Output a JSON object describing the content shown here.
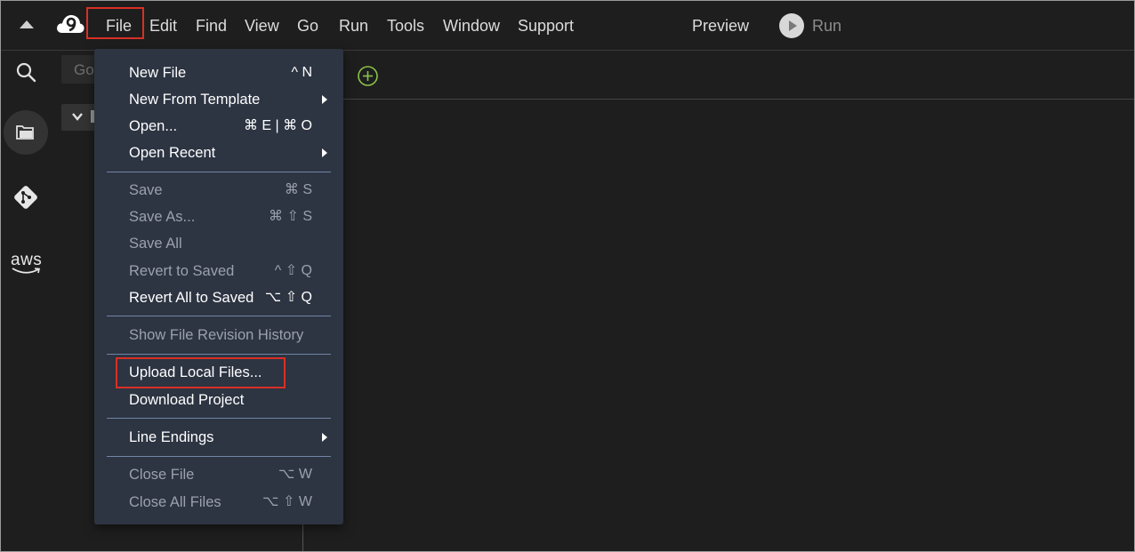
{
  "menubar": {
    "items": [
      {
        "id": "file",
        "label": "File"
      },
      {
        "id": "edit",
        "label": "Edit"
      },
      {
        "id": "find",
        "label": "Find"
      },
      {
        "id": "view",
        "label": "View"
      },
      {
        "id": "go",
        "label": "Go"
      },
      {
        "id": "run",
        "label": "Run"
      },
      {
        "id": "tools",
        "label": "Tools"
      },
      {
        "id": "window",
        "label": "Window"
      },
      {
        "id": "support",
        "label": "Support"
      }
    ],
    "preview_label": "Preview",
    "run_label": "Run"
  },
  "sidebar": {
    "icons": [
      "search-icon",
      "files-icon",
      "git-icon",
      "aws-icon"
    ],
    "aws_label": "aws"
  },
  "explorer": {
    "goto_placeholder": "Go"
  },
  "file_menu": {
    "items": [
      {
        "label": "New File",
        "shortcut": "^ N",
        "enabled": true,
        "submenu": false
      },
      {
        "label": "New From Template",
        "shortcut": "",
        "enabled": true,
        "submenu": true
      },
      {
        "label": "Open...",
        "shortcut": "⌘ E | ⌘ O",
        "enabled": true,
        "submenu": false
      },
      {
        "label": "Open Recent",
        "shortcut": "",
        "enabled": true,
        "submenu": true
      },
      {
        "label": "Save",
        "shortcut": "⌘ S",
        "enabled": false,
        "submenu": false
      },
      {
        "label": "Save As...",
        "shortcut": "⌘ ⇧ S",
        "enabled": false,
        "submenu": false
      },
      {
        "label": "Save All",
        "shortcut": "",
        "enabled": false,
        "submenu": false
      },
      {
        "label": "Revert to Saved",
        "shortcut": "^ ⇧ Q",
        "enabled": false,
        "submenu": false
      },
      {
        "label": "Revert All to Saved",
        "shortcut": "⌥ ⇧ Q",
        "enabled": true,
        "submenu": false
      },
      {
        "label": "Show File Revision History",
        "shortcut": "",
        "enabled": false,
        "submenu": false
      },
      {
        "label": "Upload Local Files...",
        "shortcut": "",
        "enabled": true,
        "submenu": false
      },
      {
        "label": "Download Project",
        "shortcut": "",
        "enabled": true,
        "submenu": false
      },
      {
        "label": "Line Endings",
        "shortcut": "",
        "enabled": true,
        "submenu": true
      },
      {
        "label": "Close File",
        "shortcut": "⌥ W",
        "enabled": false,
        "submenu": false
      },
      {
        "label": "Close All Files",
        "shortcut": "⌥ ⇧ W",
        "enabled": false,
        "submenu": false
      }
    ]
  },
  "highlights": [
    "File",
    "Upload Local Files..."
  ],
  "colors": {
    "background": "#1e1e1e",
    "menu_background": "#2d3442",
    "separator": "#6f86a4",
    "highlight_box": "#d93025",
    "add_tab_icon": "#8bc34a"
  }
}
